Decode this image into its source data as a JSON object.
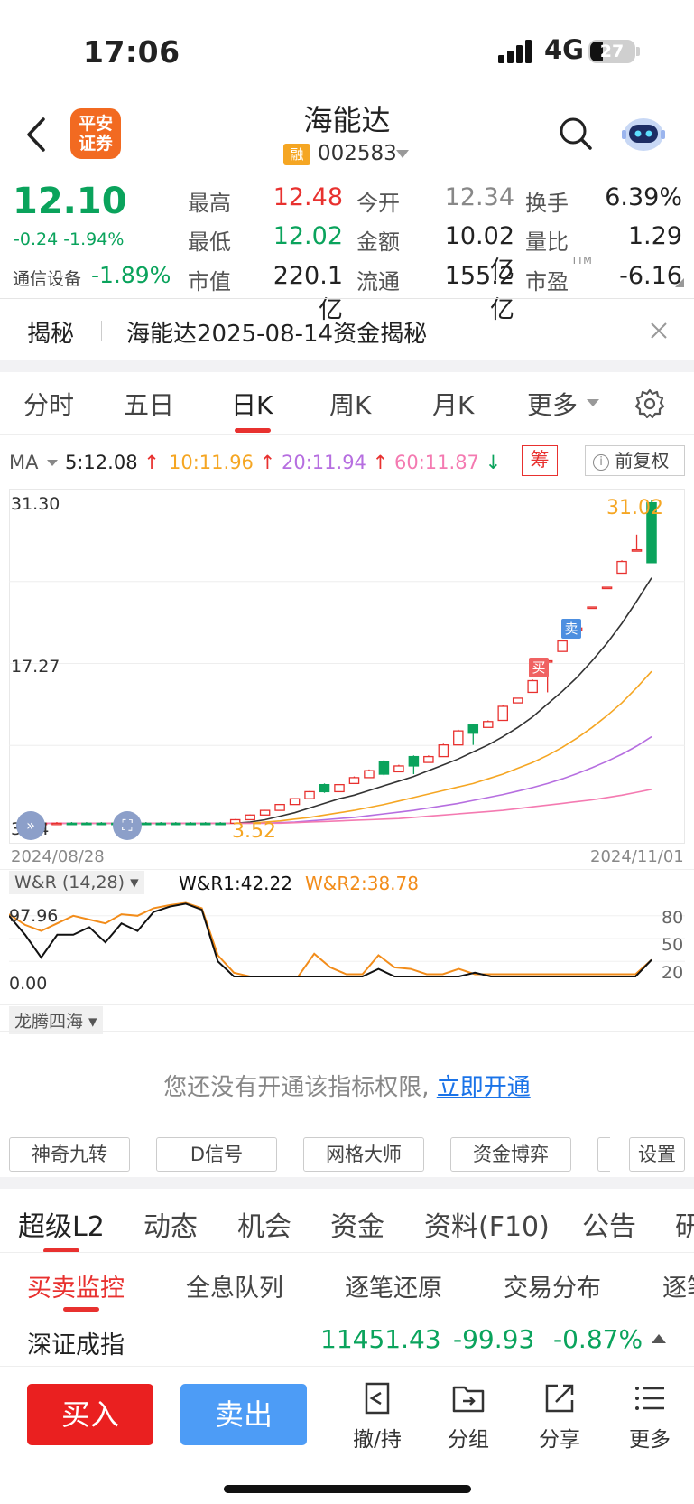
{
  "status_bar": {
    "time": "17:06",
    "network": "4G",
    "battery": "27"
  },
  "header": {
    "broker_logo": "平安证券",
    "stock_name": "海能达",
    "rong_badge": "融",
    "stock_code": "002583",
    "icons": [
      "back-arrow-icon",
      "search-icon",
      "robot-assistant-icon"
    ]
  },
  "quote": {
    "price": "12.10",
    "change": "-0.24 -1.94%",
    "sector_name": "通信设备",
    "sector_change": "-1.89%",
    "fields": [
      {
        "label": "最高",
        "value": "12.48",
        "color": "#e8312f"
      },
      {
        "label": "今开",
        "value": "12.34",
        "color": "#888888"
      },
      {
        "label": "换手",
        "value": "6.39%",
        "color": "#222222"
      },
      {
        "label": "最低",
        "value": "12.02",
        "color": "#0aa35c"
      },
      {
        "label": "金额",
        "value": "10.02亿",
        "color": "#222222"
      },
      {
        "label": "量比",
        "value": "1.29",
        "color": "#222222"
      },
      {
        "label": "市值",
        "value": "220.1亿",
        "color": "#222222"
      },
      {
        "label": "流通",
        "value": "155.2亿",
        "color": "#222222"
      },
      {
        "label": "市盈",
        "value": "-6.16",
        "color": "#222222"
      }
    ],
    "pe_suffix": "TTM"
  },
  "reveal": {
    "tag": "揭秘",
    "text": "海能达2025-08-14资金揭秘"
  },
  "kline_tabs": [
    "分时",
    "五日",
    "日K",
    "周K",
    "月K",
    "更多"
  ],
  "kline_active": "日K",
  "ma": {
    "label": "MA",
    "items": [
      {
        "text": "5:12.08",
        "arrow": "↑",
        "color": "#333333",
        "arrow_color": "#e8312f"
      },
      {
        "text": "10:11.96",
        "arrow": "↑",
        "color": "#f5a623",
        "arrow_color": "#e8312f"
      },
      {
        "text": "20:11.94",
        "arrow": "↑",
        "color": "#b66ee0",
        "arrow_color": "#e8312f"
      },
      {
        "text": "60:11.87",
        "arrow": "↓",
        "color": "#f47ab1",
        "arrow_color": "#0aa35c"
      }
    ],
    "chip_label": "筹",
    "adjust_label": "前复权"
  },
  "chart_data": [
    {
      "type": "candlestick",
      "y_labels": [
        "31.30",
        "17.27",
        "3.24"
      ],
      "ylim": [
        3.24,
        31.3
      ],
      "x_labels": [
        "2024/08/28",
        "2024/11/01"
      ],
      "annotations": {
        "high": "31.02",
        "low": "3.52",
        "buy": "买",
        "sell": "卖"
      },
      "candles": [
        {
          "o": 3.6,
          "c": 3.6,
          "h": 3.7,
          "l": 3.5
        },
        {
          "o": 3.6,
          "c": 3.6,
          "h": 3.7,
          "l": 3.5
        },
        {
          "o": 3.6,
          "c": 3.6,
          "h": 3.7,
          "l": 3.5
        },
        {
          "o": 3.6,
          "c": 3.55,
          "h": 3.7,
          "l": 3.5
        },
        {
          "o": 3.6,
          "c": 3.55,
          "h": 3.7,
          "l": 3.5
        },
        {
          "o": 3.6,
          "c": 3.55,
          "h": 3.7,
          "l": 3.5
        },
        {
          "o": 3.6,
          "c": 3.55,
          "h": 3.7,
          "l": 3.5
        },
        {
          "o": 3.6,
          "c": 3.55,
          "h": 3.7,
          "l": 3.5
        },
        {
          "o": 3.6,
          "c": 3.55,
          "h": 3.7,
          "l": 3.5
        },
        {
          "o": 3.6,
          "c": 3.55,
          "h": 3.7,
          "l": 3.5
        },
        {
          "o": 3.6,
          "c": 3.55,
          "h": 3.7,
          "l": 3.5
        },
        {
          "o": 3.6,
          "c": 3.55,
          "h": 3.7,
          "l": 3.5
        },
        {
          "o": 3.6,
          "c": 3.55,
          "h": 3.7,
          "l": 3.52
        },
        {
          "o": 3.6,
          "c": 3.55,
          "h": 3.7,
          "l": 3.52
        },
        {
          "o": 3.6,
          "c": 3.9,
          "h": 3.95,
          "l": 3.6
        },
        {
          "o": 3.9,
          "c": 4.3,
          "h": 4.35,
          "l": 3.9
        },
        {
          "o": 4.3,
          "c": 4.7,
          "h": 4.75,
          "l": 4.3
        },
        {
          "o": 4.7,
          "c": 5.2,
          "h": 5.25,
          "l": 4.7
        },
        {
          "o": 5.2,
          "c": 5.7,
          "h": 5.75,
          "l": 5.2
        },
        {
          "o": 5.7,
          "c": 6.3,
          "h": 6.35,
          "l": 5.7
        },
        {
          "o": 6.9,
          "c": 6.3,
          "h": 7.0,
          "l": 6.2
        },
        {
          "o": 6.3,
          "c": 6.9,
          "h": 6.95,
          "l": 6.3
        },
        {
          "o": 7.0,
          "c": 7.5,
          "h": 7.6,
          "l": 7.0
        },
        {
          "o": 7.5,
          "c": 8.1,
          "h": 8.2,
          "l": 7.5
        },
        {
          "o": 8.9,
          "c": 7.8,
          "h": 9.0,
          "l": 7.7
        },
        {
          "o": 8.0,
          "c": 8.5,
          "h": 8.6,
          "l": 8.0
        },
        {
          "o": 9.3,
          "c": 8.5,
          "h": 9.4,
          "l": 7.8
        },
        {
          "o": 8.8,
          "c": 9.3,
          "h": 9.4,
          "l": 8.8
        },
        {
          "o": 9.3,
          "c": 10.3,
          "h": 10.4,
          "l": 9.3
        },
        {
          "o": 10.3,
          "c": 11.5,
          "h": 11.6,
          "l": 10.3
        },
        {
          "o": 12.0,
          "c": 11.3,
          "h": 12.1,
          "l": 10.3
        },
        {
          "o": 11.8,
          "c": 12.3,
          "h": 12.4,
          "l": 11.8
        },
        {
          "o": 12.4,
          "c": 13.6,
          "h": 13.7,
          "l": 12.4
        },
        {
          "o": 13.9,
          "c": 14.3,
          "h": 14.3,
          "l": 13.9
        },
        {
          "o": 14.8,
          "c": 15.8,
          "h": 15.9,
          "l": 14.8
        },
        {
          "o": 17.5,
          "c": 17.5,
          "h": 17.5,
          "l": 14.8
        },
        {
          "o": 18.3,
          "c": 19.2,
          "h": 19.3,
          "l": 18.3
        },
        {
          "o": 20.1,
          "c": 20.3,
          "h": 20.4,
          "l": 20.1
        },
        {
          "o": 22.0,
          "c": 22.1,
          "h": 22.1,
          "l": 22.0
        },
        {
          "o": 23.8,
          "c": 23.8,
          "h": 23.8,
          "l": 23.8
        },
        {
          "o": 25.0,
          "c": 26.0,
          "h": 26.1,
          "l": 25.0
        },
        {
          "o": 27.0,
          "c": 27.0,
          "h": 28.3,
          "l": 27.0
        },
        {
          "o": 31.02,
          "c": 25.9,
          "h": 31.3,
          "l": 25.9
        }
      ],
      "ma_series": [
        {
          "name": "MA5",
          "color": "#333333",
          "values": [
            3.6,
            3.6,
            3.6,
            3.6,
            3.6,
            3.6,
            3.6,
            3.6,
            3.6,
            3.6,
            3.6,
            3.6,
            3.6,
            3.6,
            3.6,
            3.7,
            3.9,
            4.2,
            4.5,
            4.9,
            5.3,
            5.7,
            6.0,
            6.4,
            6.8,
            7.2,
            7.6,
            8.1,
            8.6,
            9.1,
            9.7,
            10.3,
            11.0,
            11.8,
            12.7,
            13.8,
            14.9,
            16.1,
            17.5,
            19.0,
            20.7,
            22.6,
            24.6
          ]
        },
        {
          "name": "MA10",
          "color": "#f5a623",
          "values": [
            3.6,
            3.6,
            3.6,
            3.6,
            3.6,
            3.6,
            3.6,
            3.6,
            3.6,
            3.6,
            3.6,
            3.6,
            3.6,
            3.6,
            3.6,
            3.6,
            3.7,
            3.8,
            3.95,
            4.1,
            4.3,
            4.5,
            4.7,
            4.95,
            5.2,
            5.5,
            5.8,
            6.1,
            6.4,
            6.7,
            7.0,
            7.4,
            7.8,
            8.3,
            8.8,
            9.4,
            10.1,
            10.9,
            11.8,
            12.8,
            13.9,
            15.2,
            16.6
          ]
        },
        {
          "name": "MA20",
          "color": "#b66ee0",
          "values": [
            3.6,
            3.6,
            3.6,
            3.6,
            3.6,
            3.6,
            3.6,
            3.6,
            3.6,
            3.6,
            3.6,
            3.6,
            3.6,
            3.6,
            3.6,
            3.6,
            3.6,
            3.65,
            3.7,
            3.8,
            3.9,
            4.0,
            4.1,
            4.25,
            4.4,
            4.55,
            4.7,
            4.9,
            5.1,
            5.3,
            5.55,
            5.8,
            6.05,
            6.35,
            6.65,
            7.0,
            7.4,
            7.85,
            8.35,
            8.9,
            9.5,
            10.2,
            11.0
          ]
        },
        {
          "name": "MA60",
          "color": "#f47ab1",
          "values": [
            3.6,
            3.6,
            3.6,
            3.6,
            3.6,
            3.6,
            3.6,
            3.6,
            3.6,
            3.6,
            3.6,
            3.6,
            3.6,
            3.6,
            3.6,
            3.6,
            3.6,
            3.6,
            3.65,
            3.7,
            3.75,
            3.8,
            3.85,
            3.9,
            3.95,
            4.0,
            4.1,
            4.2,
            4.3,
            4.4,
            4.5,
            4.6,
            4.7,
            4.85,
            5.0,
            5.15,
            5.3,
            5.45,
            5.6,
            5.8,
            6.0,
            6.25,
            6.5
          ]
        }
      ]
    },
    {
      "type": "line",
      "title": "W&R (14,28)",
      "legend": [
        {
          "label": "W&R1:42.22",
          "color": "#111111"
        },
        {
          "label": "W&R2:38.78",
          "color": "#f28c1a"
        }
      ],
      "y_labels": [
        "97.96",
        "0.00"
      ],
      "ylim": [
        0,
        100
      ],
      "ref_lines": [
        "80",
        "50",
        "20"
      ],
      "series": [
        {
          "name": "W&R1",
          "color": "#111111",
          "values": [
            80,
            55,
            25,
            55,
            55,
            65,
            45,
            70,
            60,
            85,
            92,
            96,
            88,
            20,
            0,
            0,
            0,
            0,
            0,
            0,
            0,
            0,
            0,
            10,
            0,
            0,
            0,
            0,
            0,
            5,
            0,
            0,
            0,
            0,
            0,
            0,
            0,
            0,
            0,
            0,
            22
          ]
        },
        {
          "name": "W&R2",
          "color": "#f28c1a",
          "values": [
            82,
            68,
            60,
            70,
            80,
            75,
            70,
            82,
            80,
            90,
            94,
            97,
            90,
            28,
            5,
            0,
            0,
            0,
            0,
            30,
            12,
            3,
            3,
            28,
            12,
            10,
            3,
            3,
            10,
            3,
            3,
            3,
            3,
            3,
            3,
            3,
            3,
            3,
            3,
            3,
            22
          ]
        }
      ]
    }
  ],
  "sub_indicator": {
    "label": "龙腾四海",
    "permission_text": "您还没有开通该指标权限,",
    "permission_link": "立即开通"
  },
  "indicator_buttons": [
    "神奇九转",
    "D信号",
    "网格大师",
    "资金博弈",
    "设置"
  ],
  "feature_tabs": [
    "超级L2",
    "动态",
    "机会",
    "资金",
    "资料(F10)",
    "公告",
    "研"
  ],
  "sub_tabs": [
    "买卖监控",
    "全息队列",
    "逐笔还原",
    "交易分布",
    "逐笔"
  ],
  "index_row": {
    "name": "深证成指",
    "value": "11451.43",
    "change": "-99.93",
    "pct": "-0.87%"
  },
  "bottom_bar": {
    "buy": "买入",
    "sell": "卖出",
    "tools": [
      "撤/持",
      "分组",
      "分享",
      "更多"
    ]
  }
}
